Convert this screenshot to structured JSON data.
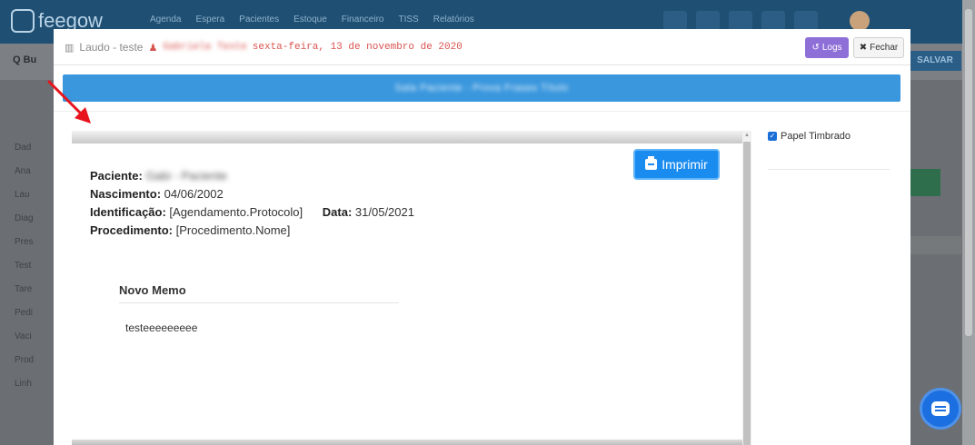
{
  "background_app": {
    "logo_text": "feegow",
    "menu": [
      "Agenda",
      "Espera",
      "Pacientes",
      "Estoque",
      "Financeiro",
      "TISS",
      "Relatórios"
    ],
    "search_label": "Q  Bu",
    "salvar_label": "SALVAR",
    "sidebar_items": [
      "Dad",
      "Ana",
      "Lau",
      "Diag",
      "Pres",
      "Test",
      "Tare",
      "Pedi",
      "Vaci",
      "Prod",
      "Linh"
    ]
  },
  "modal": {
    "title": "Laudo - teste",
    "patient_name": "Gabriela Teste",
    "date": "sexta-feira, 13 de novembro de 2020",
    "logs_label": "Logs",
    "close_label": "Fechar",
    "banner_text": "Sala Paciente - Prova Frases Título",
    "print_label": "Imprimir",
    "papel_timbrado_label": "Papel Timbrado",
    "papel_timbrado_checked": true
  },
  "document": {
    "paciente_label": "Paciente:",
    "paciente_value": "Gabi - Paciente",
    "nascimento_label": "Nascimento:",
    "nascimento_value": "04/06/2002",
    "identificacao_label": "Identificação:",
    "identificacao_value": "[Agendamento.Protocolo]",
    "data_label": "Data:",
    "data_value": "31/05/2021",
    "procedimento_label": "Procedimento:",
    "procedimento_value": "[Procedimento.Nome]",
    "memo_title": "Novo Memo",
    "memo_text": "testeeeeeeeee"
  },
  "colors": {
    "accent_blue": "#1a8cf0",
    "banner_blue": "#3a97dd",
    "logs_purple": "#8e6fd8",
    "patient_red": "#d9534f",
    "annotation_arrow": "#e8141c"
  }
}
